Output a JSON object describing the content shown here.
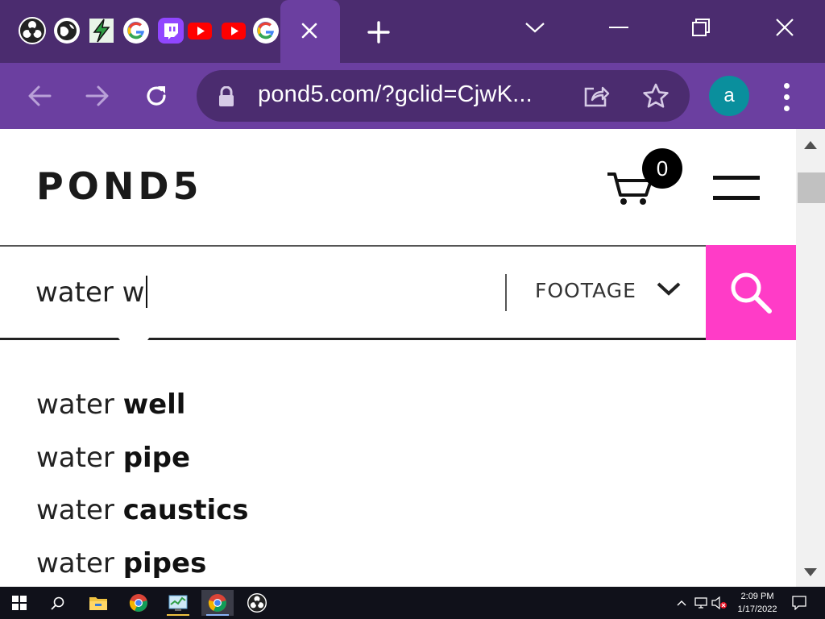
{
  "browser": {
    "tabs": [
      {
        "icon": "obs-icon"
      },
      {
        "icon": "globe-icon"
      },
      {
        "icon": "lightning-app-icon"
      },
      {
        "icon": "google-icon"
      },
      {
        "icon": "twitch-icon"
      },
      {
        "icon": "youtube-icon"
      },
      {
        "icon": "youtube-icon"
      },
      {
        "icon": "google-icon"
      }
    ],
    "url": "pond5.com/?gclid=CjwK...",
    "avatar_letter": "a",
    "theme": {
      "tabstrip": "#4b2c6f",
      "toolbar": "#6b3fa0"
    }
  },
  "page": {
    "logo": "POND5",
    "cart_count": "0",
    "search": {
      "query": "water w",
      "media_type": "FOOTAGE",
      "accent": "#ff3cc7"
    },
    "suggestions": [
      {
        "prefix": "water ",
        "completion": "well"
      },
      {
        "prefix": "water ",
        "completion": "pipe"
      },
      {
        "prefix": "water ",
        "completion": "caustics"
      },
      {
        "prefix": "water ",
        "completion": "pipes"
      }
    ]
  },
  "taskbar": {
    "apps": [
      "windows-start-icon",
      "search-icon",
      "file-explorer-icon",
      "chrome-icon",
      "task-manager-icon",
      "chrome-icon",
      "obs-icon"
    ],
    "time": "2:09 PM",
    "date": "1/17/2022"
  }
}
